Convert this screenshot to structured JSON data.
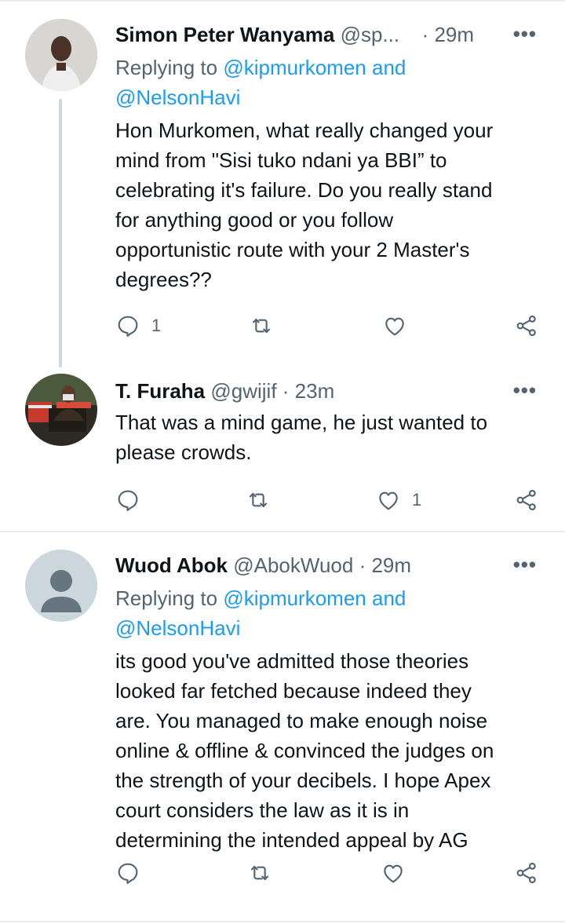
{
  "tweets": [
    {
      "name": "Simon Peter Wanyama",
      "handle": "@sp...",
      "time": "· 29m",
      "more": "•••",
      "replying_prefix": "Replying to ",
      "replying_mentions": "@kipmurkomen and",
      "replying_line2": "@NelsonHavi",
      "text": "Hon Murkomen, what really changed your\nmind from \"Sisi tuko ndani ya BBI” to\ncelebrating it's failure. Do you really stand\nfor anything good or you follow\nopportunistic route with your 2 Master's\ndegrees??",
      "reply_count": "1",
      "retweet_count": "",
      "like_count": ""
    },
    {
      "name": "T. Furaha",
      "handle": "@gwijif",
      "time": "· 23m",
      "more": "•••",
      "text": "That was a mind game, he just wanted to\nplease crowds.",
      "reply_count": "",
      "retweet_count": "",
      "like_count": "1"
    },
    {
      "name": "Wuod Abok",
      "handle": "@AbokWuod",
      "time": "· 29m",
      "more": "•••",
      "replying_prefix": "Replying to ",
      "replying_mentions": "@kipmurkomen and",
      "replying_line2": "@NelsonHavi",
      "text": "its good you've admitted those theories\nlooked far fetched because indeed they\nare. You managed to make enough noise\nonline & offline & convinced the judges on\nthe strength of your decibels. I hope Apex\ncourt considers the law as it is in\ndetermining the intended appeal by AG",
      "reply_count": "",
      "retweet_count": "",
      "like_count": ""
    }
  ],
  "colors": {
    "link": "#1d9bf0",
    "secondary_text": "#536471",
    "divider": "#e6ecf0",
    "thread_line": "#cfd9de"
  },
  "icons": [
    "reply-icon",
    "retweet-icon",
    "like-icon",
    "share-icon",
    "more-icon",
    "default-avatar-icon"
  ]
}
